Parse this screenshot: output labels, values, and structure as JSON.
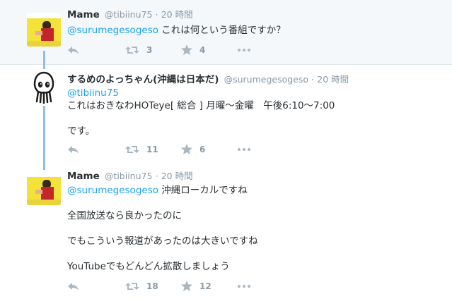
{
  "tweets": [
    {
      "fullname": "Mame",
      "username": "@tibiinu75",
      "dot": "·",
      "time": "20 時間",
      "mention": "@surumegesogeso",
      "text": " これは何という番組ですか？",
      "retweets": "3",
      "likes": "4"
    },
    {
      "fullname": "するめのよっちゃん(沖縄は日本だ)",
      "username": "@surumegesogeso",
      "dot": "·",
      "time": "20 時間",
      "mention": "@tibiinu75",
      "line1": "これはおきなわHOTeye[ 総合 ] 月曜～金曜　午後6:10～7:00",
      "line2": "です。",
      "retweets": "11",
      "likes": "6"
    },
    {
      "fullname": "Mame",
      "username": "@tibiinu75",
      "dot": "·",
      "time": "20 時間",
      "mention": "@surumegesogeso",
      "text": " 沖縄ローカルですね",
      "line2": "全国放送なら良かったのに",
      "line3": "でもこういう報道があったのは大きいですね",
      "line4": "YouTubeでもどんどん拡散しましょう",
      "retweets": "18",
      "likes": "12"
    }
  ],
  "icons": [
    "reply-icon",
    "retweet-icon",
    "like-icon",
    "more-icon"
  ],
  "colors": {
    "link": "#1da1f2",
    "muted": "#8899a6",
    "thread": "#8ec0e4",
    "highlight_bg": "#f5f8fa"
  }
}
